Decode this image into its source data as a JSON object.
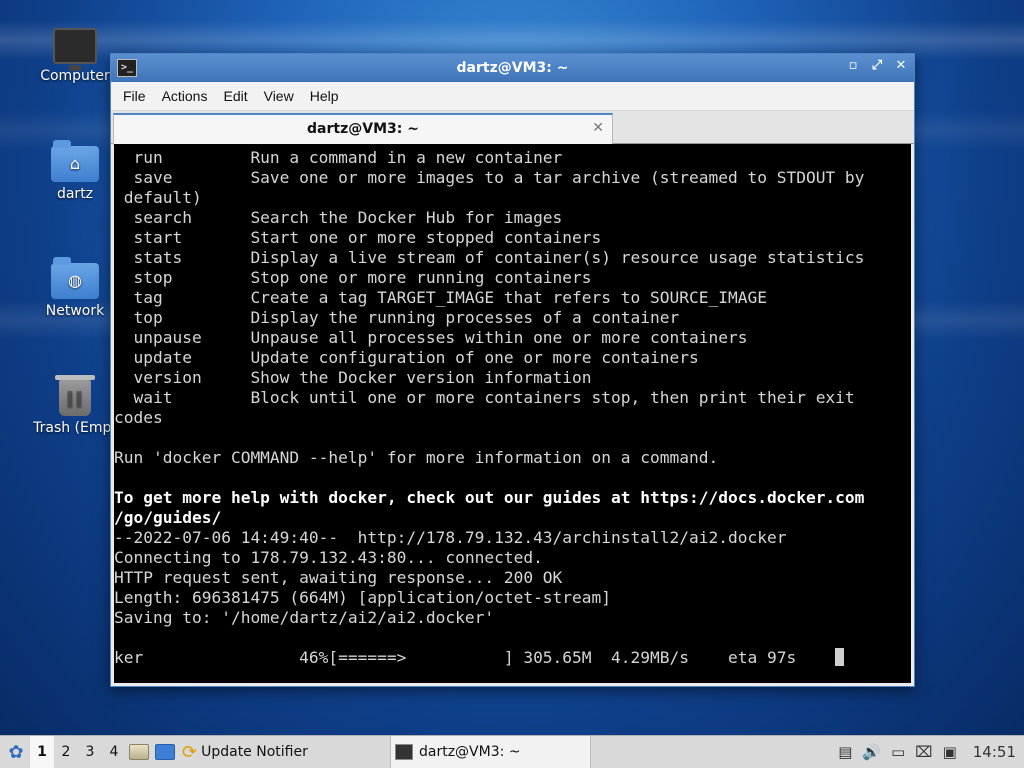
{
  "desktop": {
    "icons": [
      {
        "label": "Computer",
        "icon": "computer-icon"
      },
      {
        "label": "dartz",
        "icon": "home-folder-icon"
      },
      {
        "label": "Network",
        "icon": "network-folder-icon"
      },
      {
        "label": "Trash (Empt",
        "icon": "trash-icon"
      }
    ]
  },
  "window": {
    "title": "dartz@VM3: ~",
    "menu": [
      "File",
      "Edit",
      "View",
      "Help"
    ],
    "menu_items": {
      "file": "File",
      "actions": "Actions",
      "edit": "Edit",
      "view": "View",
      "help": "Help"
    },
    "tab_label": "dartz@VM3: ~",
    "terminal_lines": [
      "  run         Run a command in a new container",
      "  save        Save one or more images to a tar archive (streamed to STDOUT by",
      " default)",
      "  search      Search the Docker Hub for images",
      "  start       Start one or more stopped containers",
      "  stats       Display a live stream of container(s) resource usage statistics",
      "  stop        Stop one or more running containers",
      "  tag         Create a tag TARGET_IMAGE that refers to SOURCE_IMAGE",
      "  top         Display the running processes of a container",
      "  unpause     Unpause all processes within one or more containers",
      "  update      Update configuration of one or more containers",
      "  version     Show the Docker version information",
      "  wait        Block until one or more containers stop, then print their exit",
      "codes",
      "",
      "Run 'docker COMMAND --help' for more information on a command.",
      ""
    ],
    "bold_lines": [
      "To get more help with docker, check out our guides at https://docs.docker.com",
      "/go/guides/"
    ],
    "wget_lines": [
      "--2022-07-06 14:49:40--  http://178.79.132.43/archinstall2/ai2.docker",
      "Connecting to 178.79.132.43:80... connected.",
      "HTTP request sent, awaiting response... 200 OK",
      "Length: 696381475 (664M) [application/octet-stream]",
      "Saving to: '/home/dartz/ai2/ai2.docker'",
      ""
    ],
    "progress_line": "ker                46%[======>          ] 305.65M  4.29MB/s    eta 97s    ",
    "progress_percent": 46
  },
  "taskbar": {
    "workspaces": [
      "1",
      "2",
      "3",
      "4"
    ],
    "active_workspace": "1",
    "notifier_label": "Update Notifier",
    "task_label": "dartz@VM3: ~",
    "clock": "14:51"
  }
}
